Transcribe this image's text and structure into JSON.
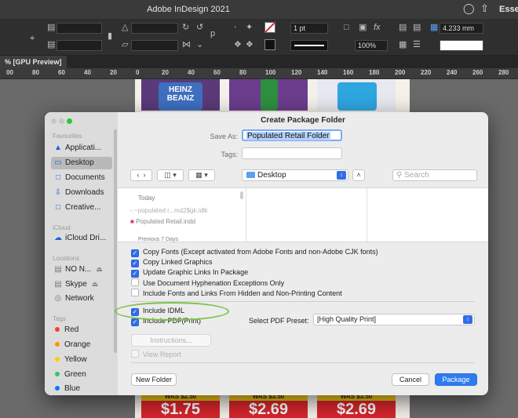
{
  "app": {
    "title": "Adobe InDesign 2021",
    "workspace_label": "Esser",
    "tab_label": "% [GPU Preview]",
    "stroke_weight": "1 pt",
    "zoom": "100%",
    "measure_value": "4.233 mm",
    "ruler_ticks": [
      "00",
      "80",
      "60",
      "40",
      "20",
      "0",
      "20",
      "40",
      "60",
      "80",
      "100",
      "120",
      "140",
      "160",
      "180",
      "200",
      "220",
      "240",
      "260",
      "280"
    ]
  },
  "canvas": {
    "brand_text": "HEINZ\nBEANZ",
    "prices": [
      {
        "was": "WAS $2.50",
        "now": "$1.75"
      },
      {
        "was": "WAS $3.50",
        "now": "$2.69"
      },
      {
        "was": "WAS $3.50",
        "now": "$2.69"
      }
    ]
  },
  "dialog": {
    "title": "Create Package Folder",
    "save_as_label": "Save As:",
    "save_as_value": "Populated Retail Folder",
    "tags_label": "Tags:",
    "tags_value": "",
    "location": "Desktop",
    "search_placeholder": "Search",
    "sidebar": {
      "favourites_label": "Favourites",
      "favourites": [
        "Applicati...",
        "Desktop",
        "Documents",
        "Downloads",
        "Creative..."
      ],
      "icloud_label": "iCloud",
      "icloud": [
        "iCloud Dri..."
      ],
      "locations_label": "Locations",
      "locations": [
        "NO N...",
        "Skype",
        "Network"
      ],
      "tags_label": "Tags",
      "tags": [
        {
          "name": "Red",
          "color": "#ff3b30"
        },
        {
          "name": "Orange",
          "color": "#ff9500"
        },
        {
          "name": "Yellow",
          "color": "#ffcc00"
        },
        {
          "name": "Green",
          "color": "#34c759"
        },
        {
          "name": "Blue",
          "color": "#007aff"
        }
      ]
    },
    "browser": {
      "today_label": "Today",
      "items": [
        "~populated r...md2$gk.idlk",
        "Populated Retail.indd"
      ],
      "previous_label": "Previous 7 Days"
    },
    "options": {
      "copy_fonts": "Copy Fonts (Except activated from Adobe Fonts and non-Adobe CJK fonts)",
      "copy_linked_graphics": "Copy Linked Graphics",
      "update_graphic_links": "Update Graphic Links In Package",
      "use_hyphenation": "Use Document Hyphenation Exceptions Only",
      "include_hidden": "Include Fonts and Links From Hidden and Non-Printing Content",
      "include_idml": "Include IDML",
      "include_pdf": "Include PDF(Print)",
      "select_preset_label": "Select PDF Preset:",
      "preset_value": "[High Quality Print]",
      "instructions_button": "Instructions...",
      "view_report": "View Report"
    },
    "buttons": {
      "new_folder": "New Folder",
      "cancel": "Cancel",
      "package": "Package"
    }
  }
}
